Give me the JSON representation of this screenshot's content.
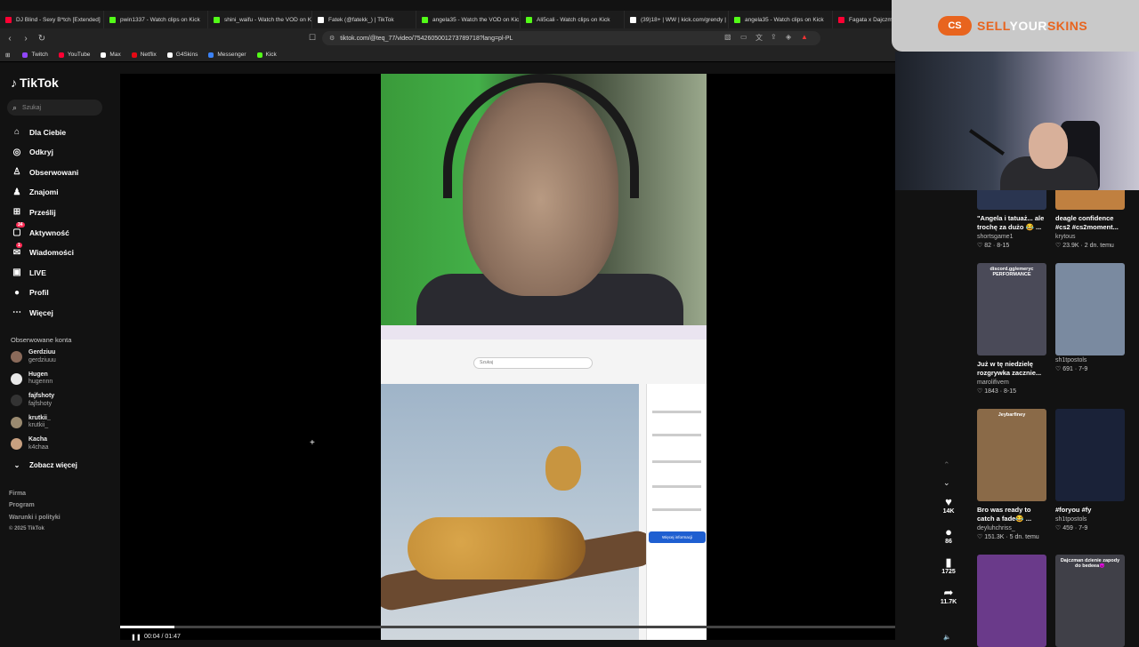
{
  "tabs": [
    {
      "title": "DJ Blind - Sexy B*tch [Extended]",
      "color": "#ff0033"
    },
    {
      "title": "pwin1337 - Watch clips on Kick",
      "color": "#53fc18"
    },
    {
      "title": "shini_waifu - Watch the VOD on K",
      "color": "#53fc18"
    },
    {
      "title": "Fatek (@fatekk_) | TikTok",
      "color": "#ffffff"
    },
    {
      "title": "angela35 - Watch the VOD on Kic",
      "color": "#53fc18"
    },
    {
      "title": "Ali5cali - Watch clips on Kick",
      "color": "#53fc18"
    },
    {
      "title": "(39)18+ | WW | kick.com/grendy |",
      "color": "#ffffff"
    },
    {
      "title": "angela35 - Watch clips on Kick",
      "color": "#53fc18"
    },
    {
      "title": "Fagata x Dajczmi",
      "color": "#ff0033"
    }
  ],
  "url": "tiktok.com/@teq_77/video/7542605001273789718?lang=pl-PL",
  "bookmarks": [
    {
      "label": "Twitch",
      "color": "#9146ff"
    },
    {
      "label": "YouTube",
      "color": "#ff0033"
    },
    {
      "label": "Max",
      "color": "#ffffff"
    },
    {
      "label": "Netflix",
      "color": "#e50914"
    },
    {
      "label": "G4Skins",
      "color": "#ffffff"
    },
    {
      "label": "Messenger",
      "color": "#3b82f6"
    },
    {
      "label": "Kick",
      "color": "#53fc18"
    }
  ],
  "logo": "TikTok",
  "search_placeholder": "Szukaj",
  "menu": [
    {
      "label": "Dla Ciebie",
      "icon": "home-icon",
      "glyph": "⌂"
    },
    {
      "label": "Odkryj",
      "icon": "compass-icon",
      "glyph": "◎"
    },
    {
      "label": "Obserwowani",
      "icon": "following-icon",
      "glyph": "♙"
    },
    {
      "label": "Znajomi",
      "icon": "friends-icon",
      "glyph": "♟"
    },
    {
      "label": "Prześlij",
      "icon": "upload-icon",
      "glyph": "⊞"
    },
    {
      "label": "Aktywność",
      "icon": "activity-icon",
      "glyph": "▢",
      "badge": "34"
    },
    {
      "label": "Wiadomości",
      "icon": "messages-icon",
      "glyph": "✉",
      "badge": "1"
    },
    {
      "label": "LIVE",
      "icon": "live-icon",
      "glyph": "▣"
    },
    {
      "label": "Profil",
      "icon": "profile-icon",
      "glyph": "●"
    },
    {
      "label": "Więcej",
      "icon": "more-icon",
      "glyph": "⋯"
    }
  ],
  "followed_heading": "Obserwowane konta",
  "followed": [
    {
      "name": "Gerdziuu",
      "handle": "gerdziuuu",
      "color": "#8a6a5a"
    },
    {
      "name": "Hugen",
      "handle": "hugennn",
      "color": "#e8e8e8"
    },
    {
      "name": "fajfshoty",
      "handle": "fajfshoty",
      "color": "#333333"
    },
    {
      "name": "krutkii_",
      "handle": "krutkii_",
      "color": "#9a8a70"
    },
    {
      "name": "Kacha",
      "handle": "k4chaa",
      "color": "#c8a080"
    }
  ],
  "see_more": "Zobacz więcej",
  "footer": [
    "Firma",
    "Program",
    "Warunki i polityki",
    "© 2025 TikTok"
  ],
  "video": {
    "progress": 0.07,
    "time": "00:04 / 01:47",
    "browser_search": "Szukaj",
    "panel_button": "Więcej informacji"
  },
  "actions": [
    {
      "icon": "heart-icon",
      "glyph": "♥",
      "count": "14K"
    },
    {
      "icon": "comment-icon",
      "glyph": "●",
      "count": "86"
    },
    {
      "icon": "bookmark-icon",
      "glyph": "▮",
      "count": "1725"
    },
    {
      "icon": "share-icon",
      "glyph": "➦",
      "count": "11.7K"
    }
  ],
  "related": [
    {
      "title": "\"Angela i tatuaż... ale trochę za dużo 😂 ...",
      "user": "shortsgame1",
      "meta": "♡ 82 · 8-15",
      "bg": "#2a3550"
    },
    {
      "title": "deagle confidence #cs2 #cs2moment...",
      "user": "krytous",
      "meta": "♡ 23.9K · 2 dn. temu",
      "bg": "#c08040"
    },
    {
      "title": "Już w tę niedzielę rozgrywka zacznie...",
      "user": "marolifivem",
      "meta": "♡ 1843 · 8-15",
      "bg": "#4a4a58",
      "label": "discord.gg/emeryc PERFORMANCE"
    },
    {
      "title": "",
      "user": "sh1tpostols",
      "meta": "♡ 691 · 7-9",
      "bg": "#7a8aa0"
    },
    {
      "title": "Bro was ready to catch a fade😂 ...",
      "user": "deyluhchriss_",
      "meta": "♡ 151.3K · 5 dn. temu",
      "bg": "#8a6a48",
      "label": "Jeybarfiney"
    },
    {
      "title": "#foryou #fy",
      "user": "sh1tpostols",
      "meta": "♡ 459 · 7-9",
      "bg": "#1a2238"
    },
    {
      "title": "",
      "user": "",
      "meta": "",
      "bg": "#6a3a8a"
    },
    {
      "title": "",
      "user": "",
      "meta": "",
      "bg": "#404048",
      "label": "Dajczman dzienie zapody do bedeea😈"
    }
  ],
  "overlay": {
    "logo": "CS",
    "brand_a": "SELL",
    "brand_b": "YOUR",
    "brand_c": "SKINS"
  }
}
